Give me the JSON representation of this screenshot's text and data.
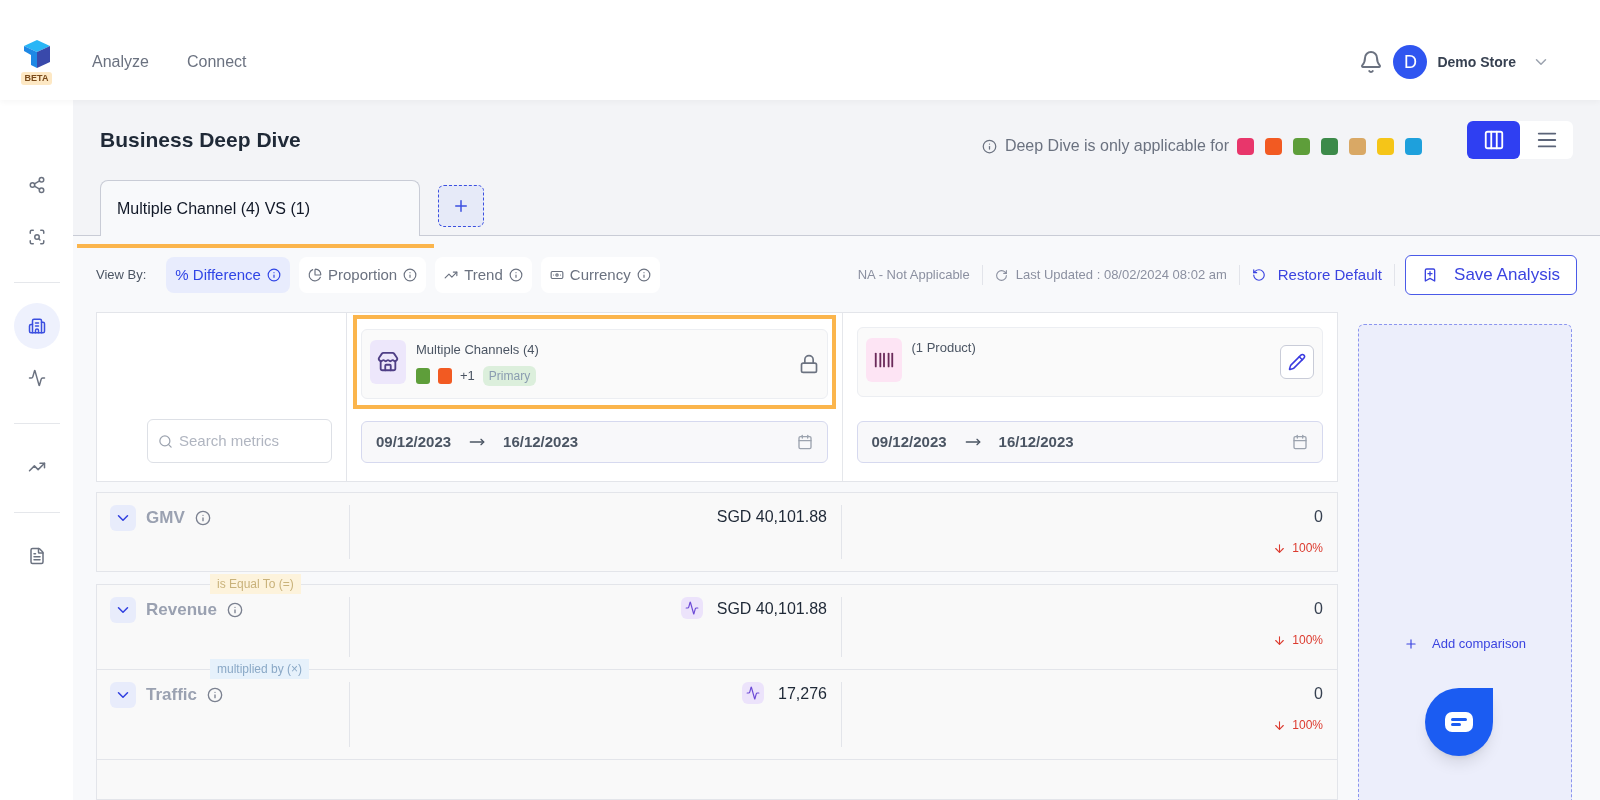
{
  "header": {
    "beta": "BETA",
    "nav": [
      {
        "label": "Analyze",
        "selected": false
      },
      {
        "label": "Connect",
        "selected": false
      }
    ],
    "avatar": "D",
    "store": "Demo Store"
  },
  "sidebar": {
    "groups": [
      {
        "items": [
          {
            "selected": false
          },
          {
            "selected": false
          }
        ]
      },
      {
        "items": [
          {
            "selected": true
          },
          {
            "selected": false
          }
        ]
      },
      {
        "items": [
          {
            "selected": false
          }
        ]
      },
      {
        "items": [
          {
            "selected": false
          }
        ]
      }
    ]
  },
  "page": {
    "title": "Business Deep Dive",
    "notice": "Deep Dive is only applicable for",
    "layouts": [
      {
        "kind": "columns",
        "selected": true
      },
      {
        "kind": "rows",
        "selected": false
      }
    ]
  },
  "tabs": [
    {
      "label": "Multiple Channel (4) VS (1)",
      "selected": true
    }
  ],
  "toolbar": {
    "view_by_label": "View By:",
    "view_by": [
      {
        "kind": "difference",
        "label": "% Difference",
        "selected": true
      },
      {
        "kind": "proportion",
        "label": "Proportion",
        "selected": false
      },
      {
        "kind": "trend",
        "label": "Trend",
        "selected": false
      },
      {
        "kind": "currency",
        "label": "Currency",
        "selected": false
      }
    ],
    "na_note": "NA - Not Applicable",
    "last_updated": "Last Updated : 08/02/2024 08:02 am",
    "restore": "Restore Default",
    "save": "Save Analysis"
  },
  "search": {
    "placeholder": "Search metrics"
  },
  "comparisons": [
    {
      "kind": "channels",
      "title": "Multiple Channels (4)",
      "extra": "+1",
      "tag": "Primary",
      "locked": true,
      "highlighted": true,
      "date_from": "09/12/2023",
      "date_to": "16/12/2023"
    },
    {
      "kind": "product",
      "title": "(1 Product)",
      "locked": false,
      "highlighted": false,
      "date_from": "09/12/2023",
      "date_to": "16/12/2023"
    }
  ],
  "add_comparison": "Add comparison",
  "metrics": [
    {
      "name": "GMV",
      "trend": false,
      "primary": "SGD 40,101.88",
      "compare": "0",
      "change": "100%",
      "decrease": true
    },
    {
      "name": "Revenue",
      "trend": true,
      "primary": "SGD 40,101.88",
      "compare": "0",
      "change": "100%",
      "decrease": true,
      "operator": {
        "kind": "equal",
        "label": "is Equal To (=)"
      }
    },
    {
      "name": "Traffic",
      "trend": true,
      "primary": "17,276",
      "compare": "0",
      "change": "100%",
      "decrease": true,
      "operator": {
        "kind": "multiply",
        "label": "multiplied by (×)"
      }
    }
  ]
}
